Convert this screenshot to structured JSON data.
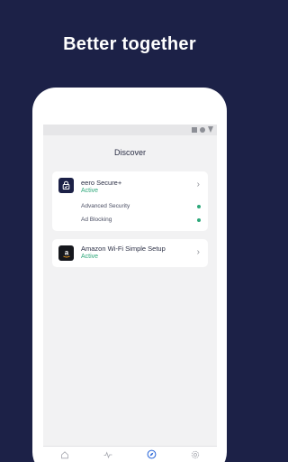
{
  "headline": "Better together",
  "screen": {
    "title": "Discover",
    "cards": [
      {
        "name": "eero Secure+",
        "status": "Active",
        "features": [
          "Advanced Security",
          "Ad Blocking"
        ]
      },
      {
        "name": "Amazon Wi-Fi Simple Setup",
        "status": "Active"
      }
    ],
    "tabs": [
      "home-icon",
      "activity-icon",
      "discover-icon",
      "settings-icon"
    ]
  },
  "colors": {
    "background": "#1c2147",
    "status_active": "#2ea87a",
    "tab_active": "#2563d8"
  }
}
